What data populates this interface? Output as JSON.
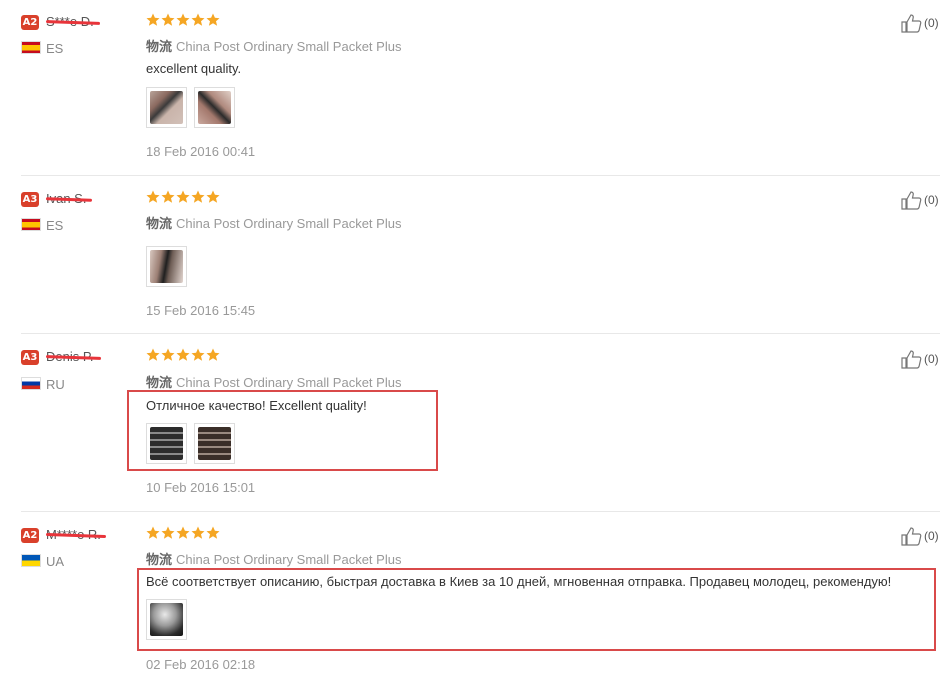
{
  "colors": {
    "accent": "#d9402b",
    "star": "#f5a623",
    "highlight_box": "#d94a4a",
    "redaction": "#e8343a"
  },
  "reviews": [
    {
      "level": "A2",
      "user": "S***e D.",
      "country_code": "ES",
      "rating": 5,
      "logistics_label": "物流",
      "logistics": "China Post Ordinary Small Packet Plus",
      "text": "excellent quality.",
      "images": [
        "wrist-photo-icon",
        "wrist-photo-icon"
      ],
      "date": "18 Feb 2016 00:41",
      "likes": "(0)"
    },
    {
      "level": "A3",
      "user": "Ivan S.",
      "country_code": "ES",
      "rating": 5,
      "logistics_label": "物流",
      "logistics": "China Post Ordinary Small Packet Plus",
      "text": "",
      "images": [
        "wrist-photo-icon"
      ],
      "date": "15 Feb 2016 15:45",
      "likes": "(0)"
    },
    {
      "level": "A3",
      "user": "Denis P.",
      "country_code": "RU",
      "rating": 5,
      "logistics_label": "物流",
      "logistics": "China Post Ordinary Small Packet Plus",
      "text": "Отличное качество! Excellent quality!",
      "images": [
        "band-photo-icon",
        "band-photo-icon"
      ],
      "date": "10 Feb 2016 15:01",
      "likes": "(0)"
    },
    {
      "level": "A2",
      "user": "M****o R.",
      "country_code": "UA",
      "rating": 5,
      "logistics_label": "物流",
      "logistics": "China Post Ordinary Small Packet Plus",
      "text": "Всё соответствует описанию, быстрая доставка в Киев за 10 дней, мгновенная отправка. Продавец молодец, рекомендую!",
      "images": [
        "dark-photo-icon"
      ],
      "date": "02 Feb 2016 02:18",
      "likes": "(0)"
    }
  ]
}
